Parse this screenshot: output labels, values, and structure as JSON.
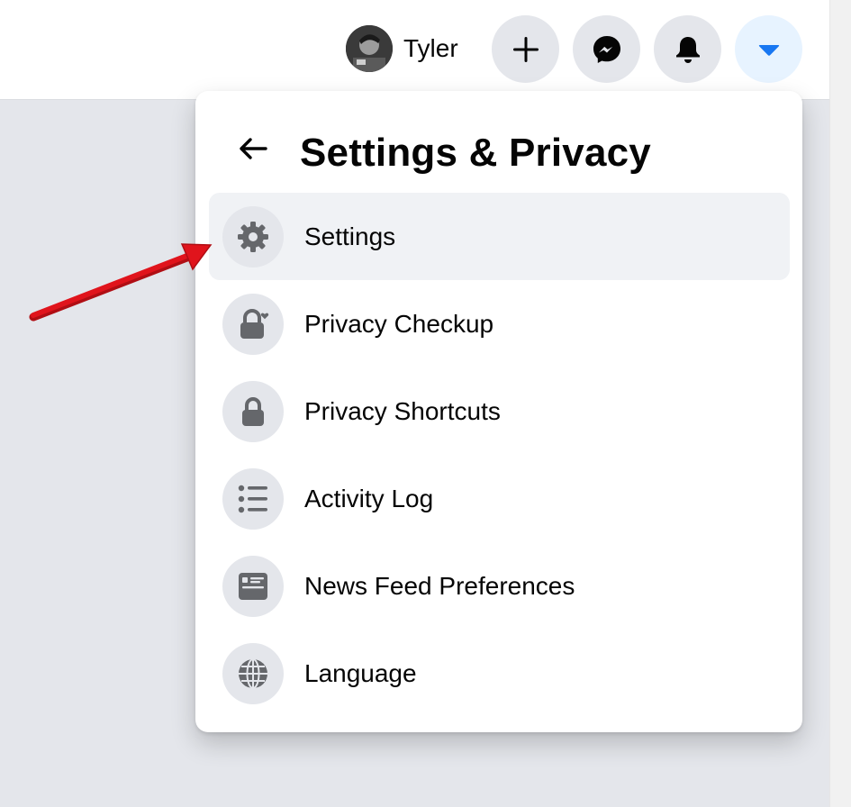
{
  "header": {
    "profile_name": "Tyler",
    "buttons": [
      {
        "name": "create",
        "icon": "plus-icon"
      },
      {
        "name": "messenger",
        "icon": "messenger-icon"
      },
      {
        "name": "notifications",
        "icon": "bell-icon"
      },
      {
        "name": "account",
        "icon": "caret-down-icon",
        "active": true
      }
    ]
  },
  "dropdown": {
    "title": "Settings & Privacy",
    "back_icon": "arrow-left-icon",
    "items": [
      {
        "label": "Settings",
        "icon": "gear-icon",
        "highlighted": true
      },
      {
        "label": "Privacy Checkup",
        "icon": "lock-heart-icon"
      },
      {
        "label": "Privacy Shortcuts",
        "icon": "lock-icon"
      },
      {
        "label": "Activity Log",
        "icon": "list-icon"
      },
      {
        "label": "News Feed Preferences",
        "icon": "feed-card-icon"
      },
      {
        "label": "Language",
        "icon": "globe-icon"
      }
    ]
  },
  "colors": {
    "accent": "#1877f2",
    "icon_gray": "#65676b",
    "annotation_arrow": "#e0141c"
  }
}
